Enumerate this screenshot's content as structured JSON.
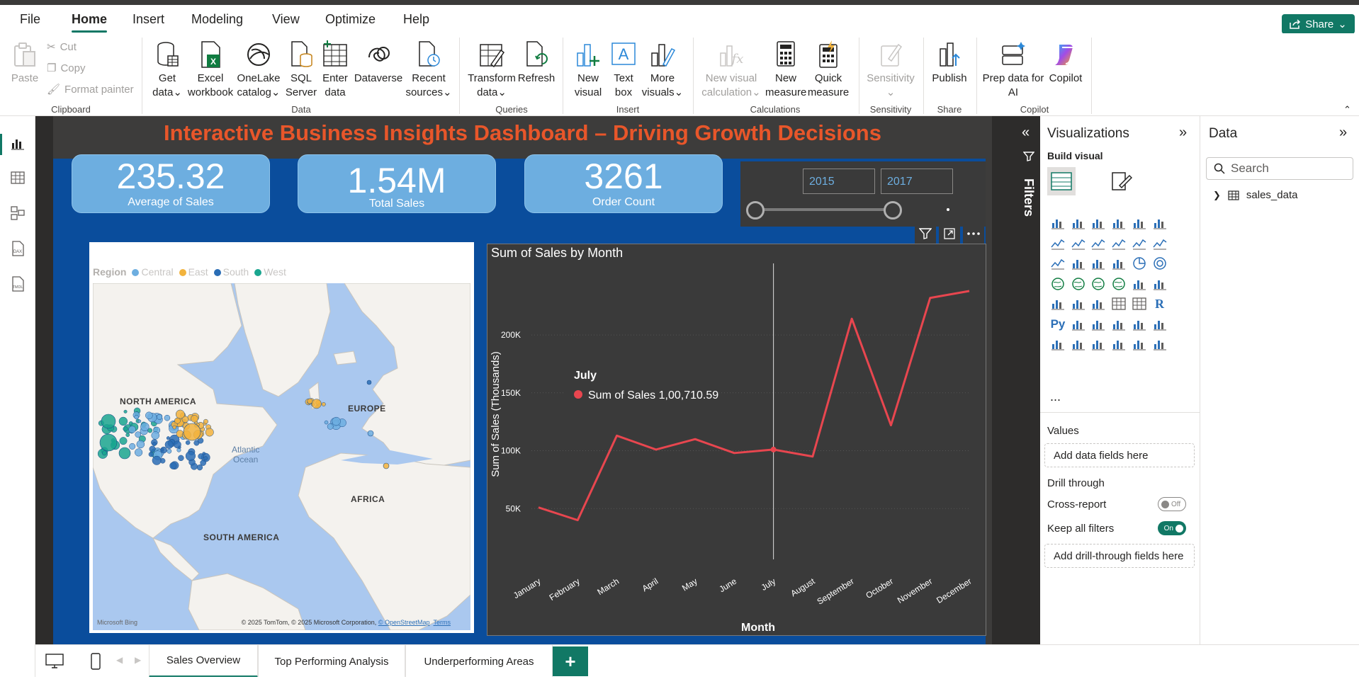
{
  "menu": {
    "items": [
      "File",
      "Home",
      "Insert",
      "Modeling",
      "View",
      "Optimize",
      "Help"
    ],
    "active": "Home",
    "share_label": "Share"
  },
  "ribbon": {
    "clipboard": {
      "paste": "Paste",
      "cut": "Cut",
      "copy": "Copy",
      "format_painter": "Format painter",
      "group": "Clipboard"
    },
    "data": {
      "get_data": [
        "Get",
        "data"
      ],
      "excel": [
        "Excel",
        "workbook"
      ],
      "onelake": [
        "OneLake",
        "catalog"
      ],
      "sql": [
        "SQL",
        "Server"
      ],
      "enter": [
        "Enter",
        "data"
      ],
      "dataverse": "Dataverse",
      "recent": [
        "Recent",
        "sources"
      ],
      "group": "Data"
    },
    "queries": {
      "transform": [
        "Transform",
        "data"
      ],
      "refresh": "Refresh",
      "group": "Queries"
    },
    "insert": {
      "new_visual": [
        "New",
        "visual"
      ],
      "text_box": [
        "Text",
        "box"
      ],
      "more_visuals": [
        "More",
        "visuals"
      ],
      "group": "Insert"
    },
    "calculations": {
      "new_visual_calc": [
        "New visual",
        "calculation"
      ],
      "new_measure": [
        "New",
        "measure"
      ],
      "quick_measure": [
        "Quick",
        "measure"
      ],
      "group": "Calculations"
    },
    "sensitivity": {
      "label": "Sensitivity",
      "group": "Sensitivity"
    },
    "share": {
      "publish": "Publish",
      "group": "Share"
    },
    "copilot": {
      "prep": [
        "Prep data for",
        "AI"
      ],
      "copilot": "Copilot",
      "group": "Copilot"
    }
  },
  "report": {
    "title": "Interactive Business Insights Dashboard – Driving Growth Decisions",
    "kpis": [
      {
        "value": "235.32",
        "label": "Average of Sales"
      },
      {
        "value": "1.54M",
        "label": "Total Sales"
      },
      {
        "value": "3261",
        "label": "Order Count"
      }
    ],
    "slicer": {
      "from": "2015",
      "to": "2017",
      "range": [
        2015,
        2017
      ]
    },
    "map": {
      "legend_title": "Region",
      "legend": [
        {
          "name": "Central",
          "color": "#6daee0"
        },
        {
          "name": "East",
          "color": "#f2b33d"
        },
        {
          "name": "South",
          "color": "#2a6db5"
        },
        {
          "name": "West",
          "color": "#1aa68f"
        }
      ],
      "labels": {
        "na": "NORTH AMERICA",
        "eu": "EUROPE",
        "af": "AFRICA",
        "sa": "SOUTH AMERICA",
        "ocean": [
          "Atlantic",
          "Ocean"
        ]
      },
      "credit": "© 2025 TomTom, © 2025 Microsoft Corporation,",
      "credit_osm": "© OpenStreetMap",
      "credit_terms": "Terms",
      "bing": "Microsoft Bing"
    }
  },
  "chart_data": {
    "type": "line",
    "title": "Sum of Sales by Month",
    "xlabel": "Month",
    "ylabel": "Sum of Sales (Thousands)",
    "categories": [
      "January",
      "February",
      "March",
      "April",
      "May",
      "June",
      "July",
      "August",
      "September",
      "October",
      "November",
      "December"
    ],
    "values": [
      51,
      40,
      113,
      101,
      110,
      98,
      101,
      95,
      214,
      122,
      232,
      238
    ],
    "ylim": [
      0,
      260
    ],
    "yticks": [
      50,
      100,
      150,
      200
    ],
    "ytick_labels": [
      "50K",
      "100K",
      "150K",
      "200K"
    ],
    "color": "#e8464f",
    "tooltip": {
      "month": "July",
      "series": "Sum of Sales",
      "value": "1,00,710.59"
    },
    "grid": true
  },
  "filters": {
    "label": "Filters"
  },
  "visualizations": {
    "title": "Visualizations",
    "build_visual": "Build visual",
    "values_label": "Values",
    "values_placeholder": "Add data fields here",
    "drill_through": "Drill through",
    "cross_report": "Cross-report",
    "cross_report_state": "Off",
    "keep_filters": "Keep all filters",
    "keep_filters_state": "On",
    "drill_placeholder": "Add drill-through fields here",
    "more": "..."
  },
  "data_pane": {
    "title": "Data",
    "search_placeholder": "Search",
    "table": "sales_data"
  },
  "pages": {
    "tabs": [
      "Sales Overview",
      "Top Performing Analysis",
      "Underperforming Areas"
    ],
    "active": "Sales Overview",
    "add": "+"
  }
}
